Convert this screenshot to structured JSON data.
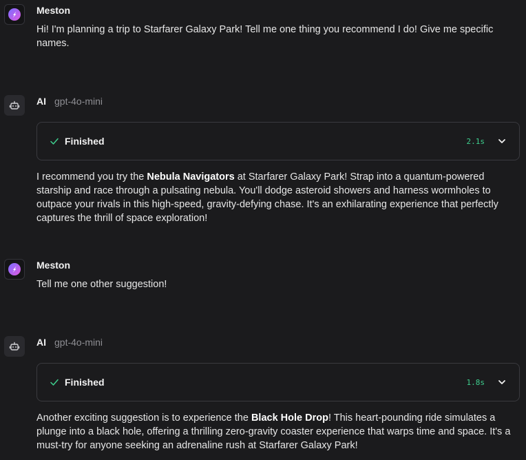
{
  "colors": {
    "background": "#1b1b1d",
    "accent_green": "#3ecf8e",
    "border": "#3a3a3f"
  },
  "messages": [
    {
      "role": "user",
      "name": "Meston",
      "text": "Hi! I'm planning a trip to Starfarer Galaxy Park! Tell me one thing you recommend I do! Give me specific names.",
      "avatar_icon": "rocket-avatar-icon"
    },
    {
      "role": "assistant",
      "name": "AI",
      "model": "gpt-4o-mini",
      "avatar_icon": "robot-icon",
      "status": {
        "label": "Finished",
        "time": "2.1s",
        "icon": "check-icon",
        "toggle_icon": "chevron-down-icon"
      },
      "text_before": "I recommend you try the ",
      "bold": "Nebula Navigators",
      "text_after": " at Starfarer Galaxy Park! Strap into a quantum-powered starship and race through a pulsating nebula. You'll dodge asteroid showers and harness wormholes to outpace your rivals in this high-speed, gravity-defying chase. It's an exhilarating experience that perfectly captures the thrill of space exploration!"
    },
    {
      "role": "user",
      "name": "Meston",
      "text": "Tell me one other suggestion!",
      "avatar_icon": "rocket-avatar-icon"
    },
    {
      "role": "assistant",
      "name": "AI",
      "model": "gpt-4o-mini",
      "avatar_icon": "robot-icon",
      "status": {
        "label": "Finished",
        "time": "1.8s",
        "icon": "check-icon",
        "toggle_icon": "chevron-down-icon"
      },
      "text_before": "Another exciting suggestion is to experience the ",
      "bold": "Black Hole Drop",
      "text_after": "! This heart-pounding ride simulates a plunge into a black hole, offering a thrilling zero-gravity coaster experience that warps time and space. It's a must-try for anyone seeking an adrenaline rush at Starfarer Galaxy Park!"
    }
  ]
}
